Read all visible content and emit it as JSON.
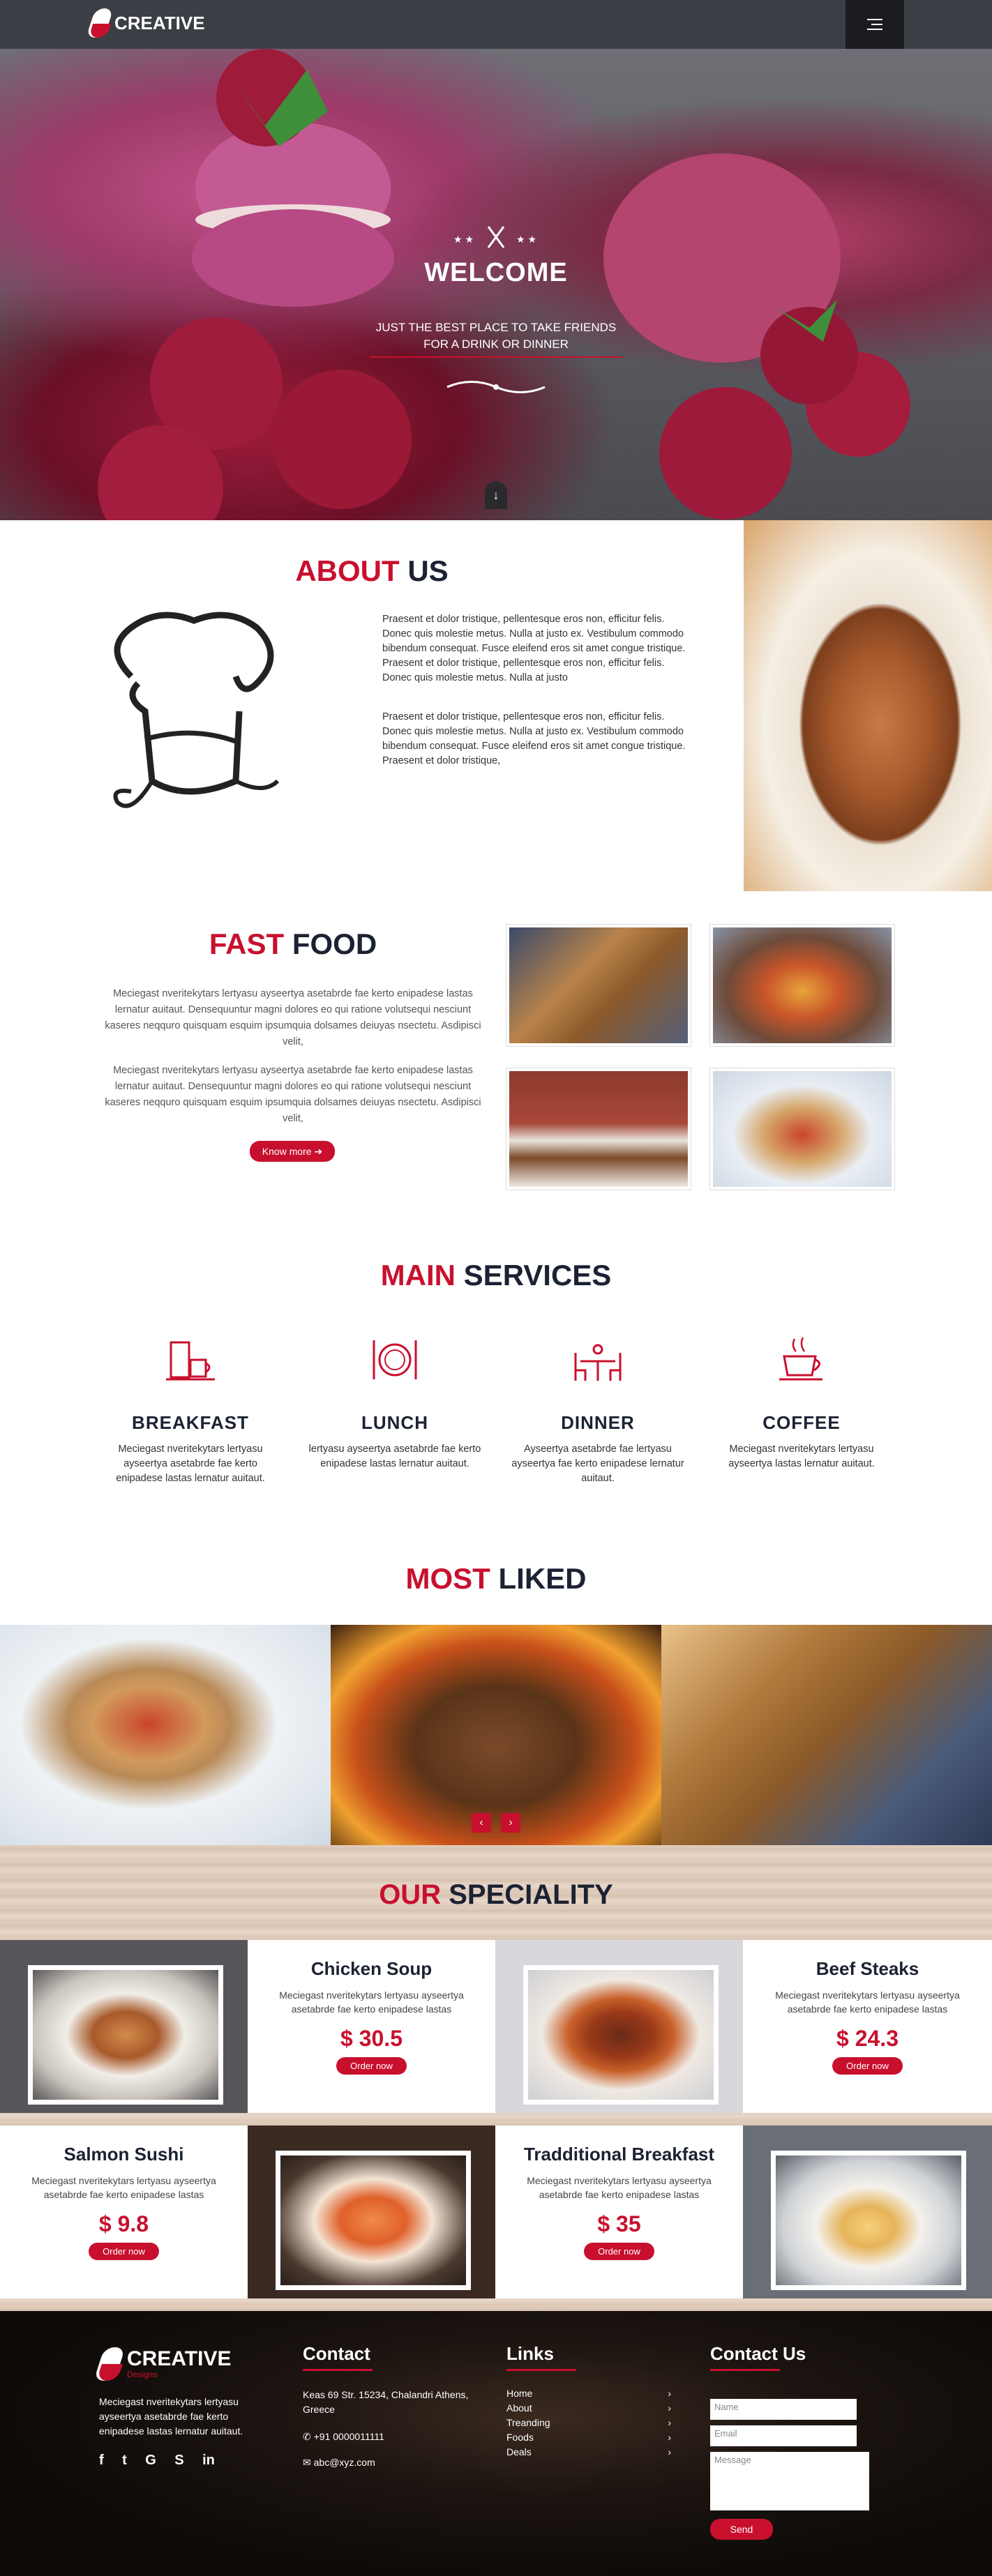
{
  "header": {
    "logo_text": "CREATIVE",
    "logo_sub": "Designs"
  },
  "hero": {
    "title": "WELCOME",
    "subtitle_line1": "JUST THE BEST PLACE TO TAKE FRIENDS",
    "subtitle_line2": "FOR A DRINK OR DINNER",
    "down_glyph": "↓"
  },
  "about": {
    "title_red": "ABOUT",
    "title_dark": "US",
    "para1": "Praesent et dolor tristique, pellentesque eros non, efficitur felis. Donec quis molestie metus. Nulla at justo ex. Vestibulum commodo bibendum consequat. Fusce eleifend eros sit amet congue tristique. Praesent et dolor tristique, pellentesque eros non, efficitur felis. Donec quis molestie metus. Nulla at justo",
    "para2": "Praesent et dolor tristique, pellentesque eros non, efficitur felis. Donec quis molestie metus. Nulla at justo ex. Vestibulum commodo bibendum consequat. Fusce eleifend eros sit amet congue tristique. Praesent et dolor tristique,"
  },
  "fastfood": {
    "title_red": "FAST",
    "title_dark": "FOOD",
    "para1": "Meciegast nveritekytars lertyasu ayseertya asetabrde fae kerto enipadese lastas lernatur auitaut. Densequuntur magni dolores eo qui ratione volutsequi nesciunt kaseres neqquro quisquam esquim ipsumquia dolsames deiuyas nsectetu. Asdipisci velit,",
    "para2": "Meciegast nveritekytars lertyasu ayseertya asetabrde fae kerto enipadese lastas lernatur auitaut. Densequuntur magni dolores eo qui ratione volutsequi nesciunt kaseres neqquro quisquam esquim ipsumquia dolsames deiuyas nsectetu. Asdipisci velit,",
    "button": "Know more ➔"
  },
  "services": {
    "title_red": "MAIN",
    "title_dark": "SERVICES",
    "items": [
      {
        "name": "BREAKFAST",
        "desc": "Meciegast nveritekytars lertyasu ayseertya asetabrde fae kerto enipadese lastas lernatur auitaut."
      },
      {
        "name": "LUNCH",
        "desc": "lertyasu ayseertya asetabrde fae kerto enipadese lastas lernatur auitaut."
      },
      {
        "name": "DINNER",
        "desc": "Ayseertya asetabrde fae lertyasu ayseertya fae kerto enipadese lernatur auitaut."
      },
      {
        "name": "COFFEE",
        "desc": "Meciegast nveritekytars lertyasu ayseertya lastas lernatur auitaut."
      }
    ]
  },
  "most_liked": {
    "title_red": "MOST",
    "title_dark": "LIKED",
    "prev": "‹",
    "next": "›"
  },
  "speciality": {
    "title_red": "OUR",
    "title_dark": "SPECIALITY",
    "items": [
      {
        "name": "Chicken Soup",
        "desc": "Meciegast nveritekytars lertyasu ayseertya asetabrde fae kerto enipadese lastas",
        "price": "$ 30.5",
        "order": "Order now"
      },
      {
        "name": "Beef Steaks",
        "desc": "Meciegast nveritekytars lertyasu ayseertya asetabrde fae kerto enipadese lastas",
        "price": "$ 24.3",
        "order": "Order now"
      },
      {
        "name": "Salmon Sushi",
        "desc": "Meciegast nveritekytars lertyasu ayseertya asetabrde fae kerto enipadese lastas",
        "price": "$ 9.8",
        "order": "Order now"
      },
      {
        "name": "Tradditional Breakfast",
        "desc": "Meciegast nveritekytars lertyasu ayseertya asetabrde fae kerto enipadese lastas",
        "price": "$ 35",
        "order": "Order now"
      }
    ]
  },
  "footer": {
    "about_text": "Meciegast nveritekytars lertyasu ayseertya asetabrde fae kerto enipadese lastas lernatur auitaut.",
    "social": [
      "f",
      "t",
      "G",
      "S",
      "in"
    ],
    "contact_title": "Contact",
    "address": "Keas 69 Str. 15234, Chalandri Athens, Greece",
    "phone": "+91 0000011111",
    "email": "abc@xyz.com",
    "links_title": "Links",
    "links": [
      "Home",
      "About",
      "Treanding",
      "Foods",
      "Deals"
    ],
    "form_title": "Contact Us",
    "name_placeholder": "Name",
    "email_placeholder": "Email",
    "message_placeholder": "Message",
    "send": "Send"
  }
}
